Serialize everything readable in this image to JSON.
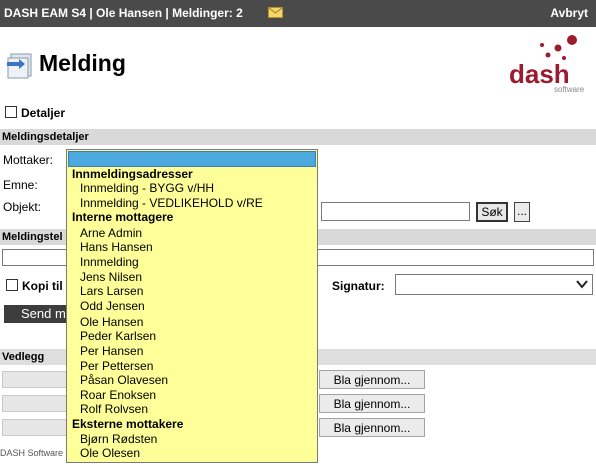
{
  "topbar": {
    "title": "DASH EAM S4 | Ole Hansen | Meldinger: 2",
    "cancel_label": "Avbryt"
  },
  "header": {
    "page_title": "Melding",
    "logo_text": "dash",
    "logo_sub": "software"
  },
  "details": {
    "label": "Detaljer",
    "checked": false
  },
  "section_meldingsdetaljer": "Meldingsdetaljer",
  "form": {
    "mottaker_label": "Mottaker:",
    "emne_label": "Emne:",
    "objekt_label": "Objekt:",
    "objekt_value": "",
    "sok_label": "Søk",
    "more_label": "..."
  },
  "section_meldingstekst": "Meldingstel",
  "kopi": {
    "label": "Kopi til",
    "checked": false
  },
  "signatur": {
    "label": "Signatur:",
    "value": ""
  },
  "send_label": "Send m",
  "section_vedlegg": "Vedlegg",
  "vedlegg": {
    "browse_label": "Bla gjennom...",
    "rows": [
      "",
      "",
      ""
    ]
  },
  "footer": "DASH Software",
  "dropdown": {
    "selected": "",
    "groups": [
      {
        "label": "Innmeldingsadresser",
        "options": [
          "Innmelding - BYGG v/HH",
          "Innmelding - VEDLIKEHOLD v/RE"
        ]
      },
      {
        "label": "Interne mottagere",
        "options": [
          "Arne Admin",
          "Hans Hansen",
          "Innmelding",
          "Jens Nilsen",
          "Lars Larsen",
          "Odd Jensen",
          "Ole Hansen",
          "Peder Karlsen",
          "Per Hansen",
          "Per Pettersen",
          "Påsan Olavesen",
          "Roar Enoksen",
          "Rolf Rolvsen"
        ]
      },
      {
        "label": "Eksterne mottakere",
        "options": [
          "Bjørn Rødsten",
          "Ole Olesen"
        ]
      }
    ]
  },
  "colors": {
    "topbar": "#4a4a4a",
    "dropdown_bg": "#ffff99",
    "dropdown_selected": "#4ea8e0",
    "logo_red": "#9b1c2e",
    "section_bg": "#d9d9d9"
  },
  "icons": {
    "mail": "envelope-icon",
    "page": "message-icon"
  }
}
